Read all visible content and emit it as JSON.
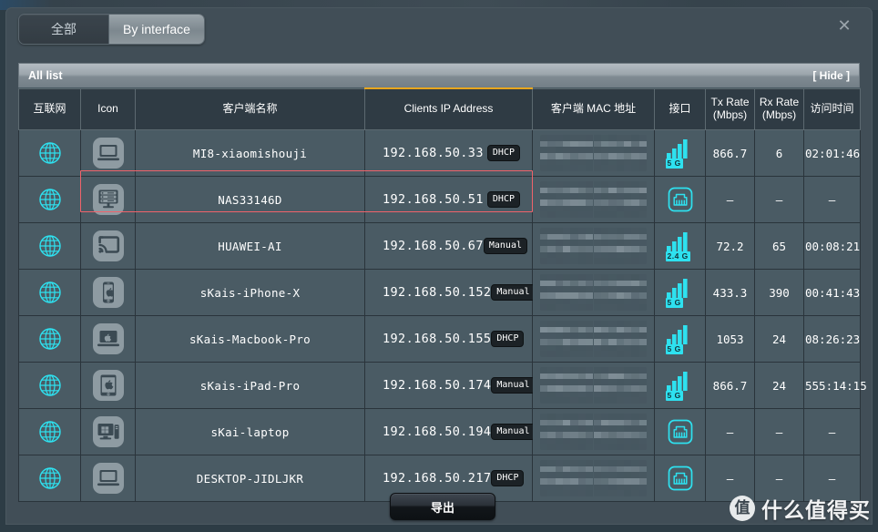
{
  "modal": {
    "close_icon": "close-icon",
    "tabs": [
      {
        "label": "全部",
        "selected": true
      },
      {
        "label": "By interface",
        "selected": false
      }
    ],
    "panel_title": "All list",
    "hide_label": "[ Hide ]",
    "export_label": "导出"
  },
  "table": {
    "columns": [
      {
        "key": "internet",
        "label": "互联网"
      },
      {
        "key": "icon",
        "label": "Icon"
      },
      {
        "key": "name",
        "label": "客户端名称"
      },
      {
        "key": "ip",
        "label": "Clients IP Address",
        "sorted": true
      },
      {
        "key": "mac",
        "label": "客户端 MAC 地址"
      },
      {
        "key": "iface",
        "label": "接口"
      },
      {
        "key": "tx",
        "label": "Tx Rate",
        "sublabel": "(Mbps)"
      },
      {
        "key": "rx",
        "label": "Rx Rate",
        "sublabel": "(Mbps)"
      },
      {
        "key": "time",
        "label": "访问时间"
      }
    ],
    "rows": [
      {
        "internet_icon": "globe-icon",
        "device_icon": "laptop-icon",
        "name": "MI8-xiaomishouji",
        "ip": "192.168.50.33",
        "ip_mode": "DHCP",
        "mac": "censored",
        "iface_icon": "wifi-icon",
        "band": "5 G",
        "tx": "866.7",
        "rx": "6",
        "time": "02:01:46",
        "highlighted": false
      },
      {
        "internet_icon": "globe-icon",
        "device_icon": "nas-server-icon",
        "name": "NAS33146D",
        "ip": "192.168.50.51",
        "ip_mode": "DHCP",
        "mac": "censored",
        "iface_icon": "ethernet-icon",
        "band": "",
        "tx": "–",
        "rx": "–",
        "time": "–",
        "highlighted": true
      },
      {
        "internet_icon": "globe-icon",
        "device_icon": "cast-screen-icon",
        "name": "HUAWEI-AI",
        "ip": "192.168.50.67",
        "ip_mode": "Manual",
        "mac": "censored",
        "iface_icon": "wifi-icon",
        "band": "2.4 G",
        "tx": "72.2",
        "rx": "65",
        "time": "00:08:21",
        "highlighted": false
      },
      {
        "internet_icon": "globe-icon",
        "device_icon": "apple-phone-icon",
        "name": "sKais-iPhone-X",
        "ip": "192.168.50.152",
        "ip_mode": "Manual",
        "mac": "censored",
        "iface_icon": "wifi-icon",
        "band": "5 G",
        "tx": "433.3",
        "rx": "390",
        "time": "00:41:43",
        "highlighted": false
      },
      {
        "internet_icon": "globe-icon",
        "device_icon": "apple-laptop-icon",
        "name": "sKais-Macbook-Pro",
        "ip": "192.168.50.155",
        "ip_mode": "DHCP",
        "mac": "censored",
        "iface_icon": "wifi-icon",
        "band": "5 G",
        "tx": "1053",
        "rx": "24",
        "time": "08:26:23",
        "highlighted": false
      },
      {
        "internet_icon": "globe-icon",
        "device_icon": "apple-tablet-icon",
        "name": "sKais-iPad-Pro",
        "ip": "192.168.50.174",
        "ip_mode": "Manual",
        "mac": "censored",
        "iface_icon": "wifi-icon",
        "band": "5 G",
        "tx": "866.7",
        "rx": "24",
        "time": "555:14:15",
        "highlighted": false
      },
      {
        "internet_icon": "globe-icon",
        "device_icon": "windows-pc-icon",
        "name": "sKai-laptop",
        "ip": "192.168.50.194",
        "ip_mode": "Manual",
        "mac": "censored",
        "iface_icon": "ethernet-icon",
        "band": "",
        "tx": "–",
        "rx": "–",
        "time": "–",
        "highlighted": false
      },
      {
        "internet_icon": "globe-icon",
        "device_icon": "laptop-icon",
        "name": "DESKTOP-JIDLJKR",
        "ip": "192.168.50.217",
        "ip_mode": "DHCP",
        "mac": "censored",
        "iface_icon": "ethernet-icon",
        "band": "",
        "tx": "–",
        "rx": "–",
        "time": "–",
        "highlighted": false
      }
    ]
  },
  "watermark": {
    "logo": "值",
    "text": "什么值得买"
  },
  "colors": {
    "accent_cyan": "#2ee1ef",
    "sort_underline": "#e8a61d",
    "highlight_red": "#f0636b",
    "panel_bg": "#414e57",
    "cell_bg": "#4a5b64",
    "header_bg": "#2f3b44"
  }
}
